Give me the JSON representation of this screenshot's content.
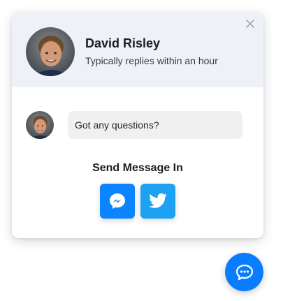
{
  "header": {
    "name": "David Risley",
    "subtitle": "Typically replies within an hour",
    "close_icon": "close-icon"
  },
  "chat": {
    "message": "Got any questions?"
  },
  "send": {
    "label": "Send Message In",
    "options": [
      {
        "name": "Messenger",
        "icon": "messenger-icon",
        "color": "#0b84ff"
      },
      {
        "name": "Twitter",
        "icon": "twitter-icon",
        "color": "#1da1f2"
      }
    ]
  },
  "launcher": {
    "icon": "chat-bubble-icon",
    "color": "#0a7cff"
  },
  "colors": {
    "header_bg": "#eef2f8",
    "bubble_bg": "#f0f0f0"
  }
}
